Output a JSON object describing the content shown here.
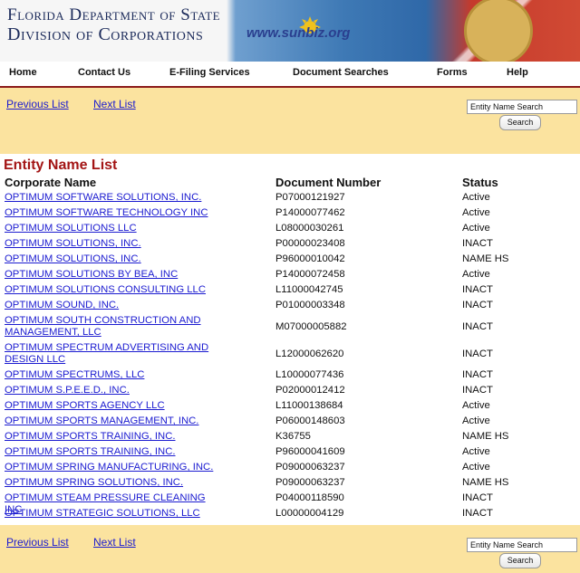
{
  "header": {
    "line1": "Florida Department of State",
    "line2": "Division of Corporations",
    "logo_text": "www.sunbiz.org"
  },
  "nav": [
    "Home",
    "Contact Us",
    "E-Filing Services",
    "Document Searches",
    "Forms",
    "Help"
  ],
  "list_nav": {
    "prev": "Previous List",
    "next": "Next List",
    "search_value": "Entity Name Search",
    "search_button": "Search"
  },
  "title": "Entity Name List",
  "columns": [
    "Corporate Name",
    "Document Number",
    "Status"
  ],
  "rows": [
    [
      "OPTIMUM SOFTWARE SOLUTIONS, INC.",
      "P07000121927",
      "Active"
    ],
    [
      "OPTIMUM SOFTWARE TECHNOLOGY INC",
      "P14000077462",
      "Active"
    ],
    [
      "OPTIMUM SOLUTIONS LLC",
      "L08000030261",
      "Active"
    ],
    [
      "OPTIMUM SOLUTIONS, INC.",
      "P00000023408",
      "INACT"
    ],
    [
      "OPTIMUM SOLUTIONS, INC.",
      "P96000010042",
      "NAME HS"
    ],
    [
      "OPTIMUM SOLUTIONS BY BEA, INC",
      "P14000072458",
      "Active"
    ],
    [
      "OPTIMUM SOLUTIONS CONSULTING LLC",
      "L11000042745",
      "INACT"
    ],
    [
      "OPTIMUM SOUND, INC.",
      "P01000003348",
      "INACT"
    ],
    [
      "OPTIMUM SOUTH CONSTRUCTION AND MANAGEMENT, LLC",
      "M07000005882",
      "INACT"
    ],
    [
      "OPTIMUM SPECTRUM ADVERTISING AND DESIGN LLC",
      "L12000062620",
      "INACT"
    ],
    [
      "OPTIMUM SPECTRUMS, LLC",
      "L10000077436",
      "INACT"
    ],
    [
      "OPTIMUM S.P.E.E.D., INC.",
      "P02000012412",
      "INACT"
    ],
    [
      "OPTIMUM SPORTS AGENCY LLC",
      "L11000138684",
      "Active"
    ],
    [
      "OPTIMUM SPORTS MANAGEMENT, INC.",
      "P06000148603",
      "Active"
    ],
    [
      "OPTIMUM SPORTS TRAINING, INC.",
      "K36755",
      "NAME HS"
    ],
    [
      "OPTIMUM SPORTS TRAINING, INC.",
      "P96000041609",
      "Active"
    ],
    [
      "OPTIMUM SPRING MANUFACTURING, INC.",
      "P09000063237",
      "Active"
    ],
    [
      "OPTIMUM SPRING SOLUTIONS, INC.",
      "P09000063237",
      "NAME HS"
    ],
    [
      "OPTIMUM STEAM PRESSURE CLEANING INC",
      "P04000118590",
      "INACT"
    ],
    [
      "OPTIMUM STRATEGIC SOLUTIONS, LLC",
      "L00000004129",
      "INACT"
    ]
  ]
}
